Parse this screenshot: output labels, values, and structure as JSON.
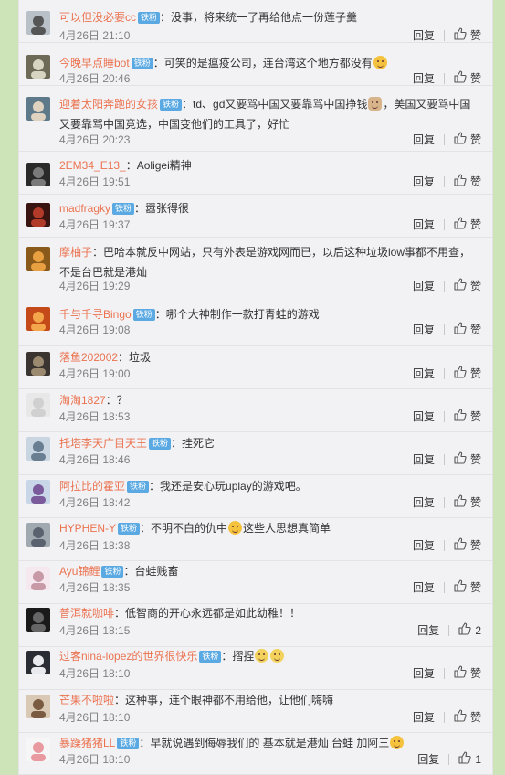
{
  "badge_label": "铁粉",
  "reply_label": "回复",
  "like_label": "赞",
  "comments": [
    {
      "user": "可以但没必要cc",
      "badge": true,
      "text": "：没事，将来统一了再给他点一份莲子羹",
      "time": "4月26日 21:10",
      "likes": "赞"
    },
    {
      "user": "今晚早点睡bot",
      "badge": true,
      "text": "：可笑的是瘟疫公司，连台湾这个地方都没有",
      "emoji": "laugh",
      "time": "4月26日 20:46",
      "likes": "赞"
    },
    {
      "user": "迎着太阳奔跑的女孩",
      "badge": true,
      "text": "：td、gd又要骂中国又要靠骂中国挣钱",
      "emoji": "cat",
      "text2": "，美国又要骂中国又要靠骂中国竞选，中国变他们的工具了，好忙",
      "time": "4月26日 20:23",
      "likes": "赞"
    },
    {
      "user": "2EM34_E13_",
      "badge": false,
      "text": "：Aoligei精神",
      "time": "4月26日 19:51",
      "likes": "赞"
    },
    {
      "user": "madfragky",
      "badge": true,
      "text": "：嚣张得很",
      "time": "4月26日 19:37",
      "likes": "赞"
    },
    {
      "user": "摩柚子",
      "badge": false,
      "text": "：巴哈本就反中网站，只有外表是游戏网而已，以后这种垃圾low事都不用查，不是台巴就是港灿",
      "time": "4月26日 19:29",
      "likes": "赞"
    },
    {
      "user": "千与千寻Bingo",
      "badge": true,
      "text": "：哪个大神制作一款打青蛙的游戏",
      "time": "4月26日 19:08",
      "likes": "赞"
    },
    {
      "user": "落鱼202002",
      "badge": false,
      "text": "：垃圾",
      "time": "4月26日 19:00",
      "likes": "赞"
    },
    {
      "user": "淘淘1827",
      "badge": false,
      "text": "：？",
      "time": "4月26日 18:53",
      "likes": "赞"
    },
    {
      "user": "托塔李天广目天王",
      "badge": true,
      "text": "：挂死它",
      "time": "4月26日 18:46",
      "likes": "赞"
    },
    {
      "user": "阿拉比的霍亚",
      "badge": true,
      "text": "：我还是安心玩uplay的游戏吧。",
      "time": "4月26日 18:42",
      "likes": "赞"
    },
    {
      "user": "HYPHEN-Y",
      "badge": true,
      "text": "：不明不白的仇中",
      "emoji": "laugh",
      "text2": "这些人思想真简单",
      "time": "4月26日 18:38",
      "likes": "赞"
    },
    {
      "user": "Ayu锦鲤",
      "badge": true,
      "text": "：台蛙贱畜",
      "time": "4月26日 18:35",
      "likes": "赞"
    },
    {
      "user": "普洱就咖啡",
      "badge": false,
      "text": "：低智商的开心永远都是如此幼稚！！",
      "time": "4月26日 18:15",
      "likes": "2"
    },
    {
      "user": "过客nina-lopez的世界很快乐",
      "badge": true,
      "text": "：摺捏",
      "emoji": "bird",
      "emoji2": "bird",
      "time": "4月26日 18:10",
      "likes": "赞"
    },
    {
      "user": "芒果不啦啦",
      "badge": false,
      "text": "：这种事，连个眼神都不用给他，让他们嗨嗨",
      "time": "4月26日 18:10",
      "likes": "赞"
    },
    {
      "user": "暴躁猪猪LL",
      "badge": true,
      "text": "：早就说遇到侮辱我们的 基本就是港灿 台蛙 加阿三",
      "emoji": "laugh",
      "time": "4月26日 18:10",
      "likes": "1"
    }
  ],
  "colors": {
    "username": "#eb7350",
    "badge": "#5aa9e2",
    "page_bg": "#cde3b8",
    "panel_bg": "#f2f2f5"
  }
}
